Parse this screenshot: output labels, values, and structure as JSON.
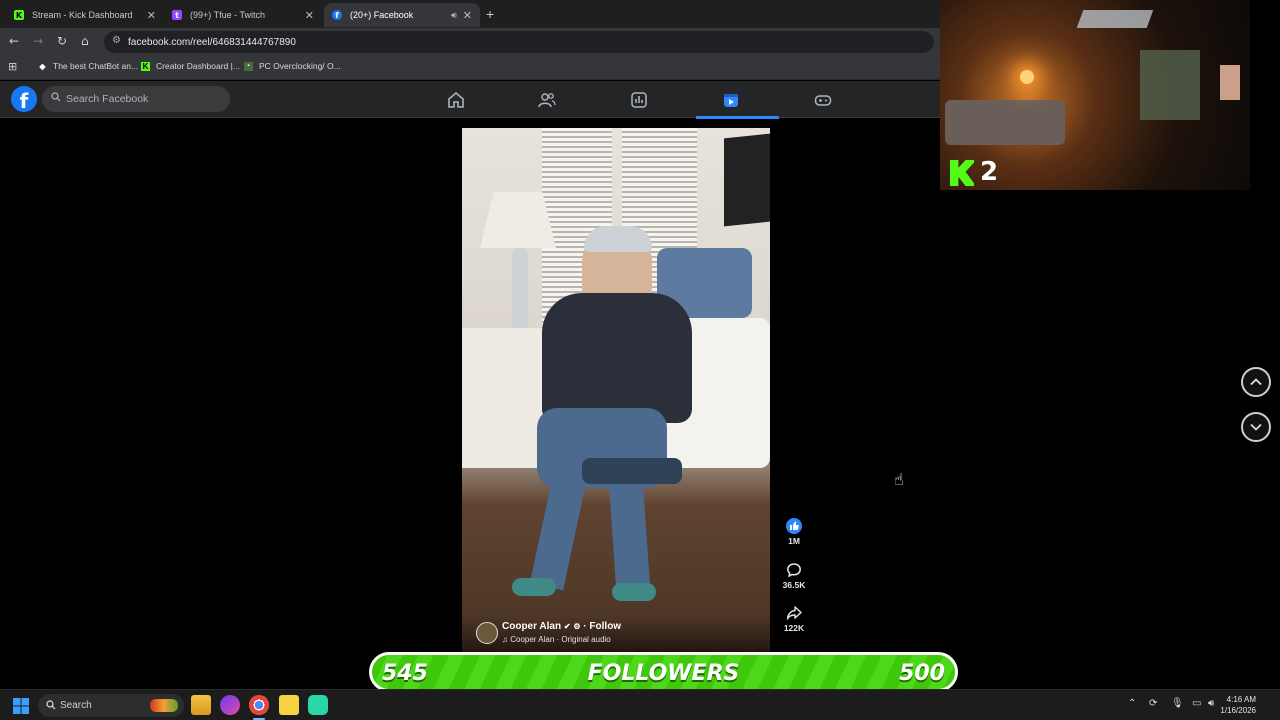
{
  "browser": {
    "tabs": [
      {
        "title": "Stream - Kick Dashboard",
        "favicon": "kick-icon"
      },
      {
        "title": "(99+) Tfue - Twitch",
        "favicon": "twitch-icon"
      },
      {
        "title": "(20+) Facebook",
        "favicon": "facebook-icon",
        "active": true,
        "audio": true
      }
    ],
    "url": "facebook.com/reel/646831444767890",
    "bookmarks": [
      {
        "label": "The best ChatBot an..."
      },
      {
        "label": "Creator Dashboard |..."
      },
      {
        "label": "PC Overclocking/ O..."
      }
    ]
  },
  "facebook": {
    "search_placeholder": "Search Facebook",
    "nav": [
      "home-icon",
      "friends-icon",
      "dashboard-icon",
      "reels-icon",
      "gaming-icon"
    ],
    "active_nav": "reels-icon"
  },
  "reel": {
    "owner": "Cooper Alan",
    "follow": "Follow",
    "audio": "Cooper Alan · Original audio",
    "likes": "1M",
    "comments": "36.5K",
    "shares": "122K"
  },
  "overlay": {
    "kick_count": "2",
    "goal_current": "545",
    "goal_label": "FOLLOWERS",
    "goal_target": "500",
    "accent": "#53fc18"
  },
  "taskbar": {
    "search": "Search",
    "time": "4:16 AM",
    "date": "1/16/2026"
  }
}
